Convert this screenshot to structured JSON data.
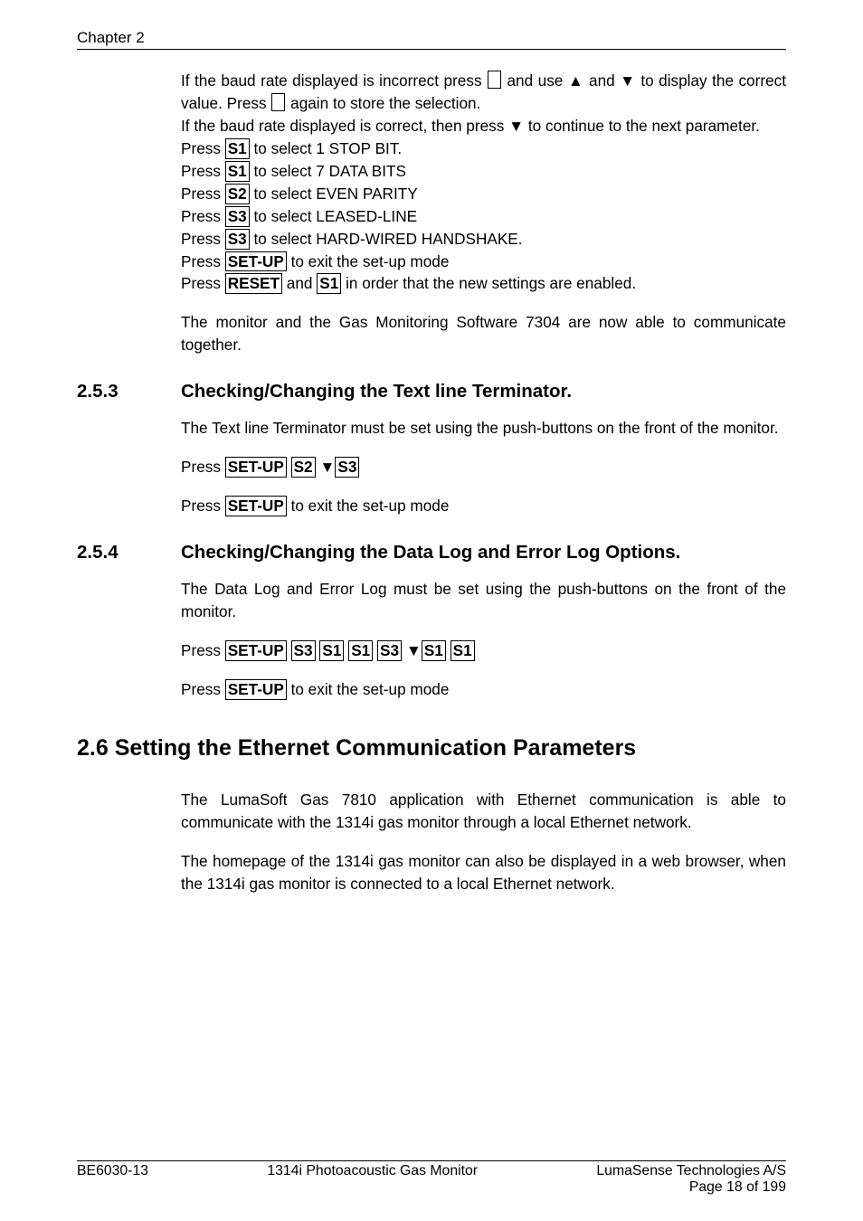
{
  "header": {
    "chapter": "Chapter 2"
  },
  "intro": {
    "line1a": "If the baud rate displayed is incorrect press ",
    "line1b": " and use ▲ and ▼ to display the correct value. Press ",
    "line1c": " again to store the selection.",
    "line2a": "If the baud rate displayed is correct, then press ▼ to continue to the next parameter.",
    "plist": [
      {
        "pre": "Press ",
        "key": "S1",
        "post": " to select 1 STOP BIT."
      },
      {
        "pre": "Press ",
        "key": "S1",
        "post": " to select 7 DATA BITS"
      },
      {
        "pre": "Press ",
        "key": "S2",
        "post": " to select EVEN PARITY"
      },
      {
        "pre": "Press ",
        "key": "S3",
        "post": " to select LEASED-LINE"
      },
      {
        "pre": "Press ",
        "key": "S3",
        "post": " to select HARD-WIRED HANDSHAKE."
      },
      {
        "pre": "Press ",
        "key": "SET-UP",
        "post": " to exit the set-up mode"
      }
    ],
    "lastline_a": "Press ",
    "lastline_key1": "RESET",
    "lastline_b": " and ",
    "lastline_key2": "S1",
    "lastline_c": " in order that the new settings are enabled.",
    "para2": "The monitor and the Gas Monitoring Software 7304 are now able to communicate together."
  },
  "sec253": {
    "num": "2.5.3",
    "title": "Checking/Changing the Text line Terminator.",
    "p1": "The Text line Terminator must be set using the push-buttons on the front of the monitor.",
    "press": "Press ",
    "keys": [
      "SET-UP",
      "S2"
    ],
    "arrow": " ▼",
    "keys2": [
      "S3"
    ],
    "p2a": "Press ",
    "p2key": "SET-UP",
    "p2b": " to exit the set-up mode"
  },
  "sec254": {
    "num": "2.5.4",
    "title": "Checking/Changing the Data Log and Error Log Options.",
    "p1": "The Data Log and Error Log must be set using the push-buttons on the front of the monitor.",
    "press": "Press ",
    "keys": [
      "SET-UP",
      "S3",
      "S1",
      "S1",
      "S3"
    ],
    "arrow": " ▼",
    "keys2": [
      "S1",
      "S1"
    ],
    "p2a": "Press ",
    "p2key": "SET-UP",
    "p2b": " to exit the set-up mode"
  },
  "sec26": {
    "title": "2.6 Setting the Ethernet Communication Parameters",
    "p1": "The LumaSoft Gas 7810 application with Ethernet communication is able to communicate with the 1314i gas monitor through a local Ethernet network.",
    "p2": "The homepage of the 1314i gas monitor can also be displayed in a web browser, when the 1314i gas monitor is connected to a local Ethernet network."
  },
  "footer": {
    "left": "BE6030-13",
    "center": "1314i Photoacoustic Gas Monitor",
    "right1": "LumaSense Technologies A/S",
    "right2": "Page 18 of 199"
  }
}
